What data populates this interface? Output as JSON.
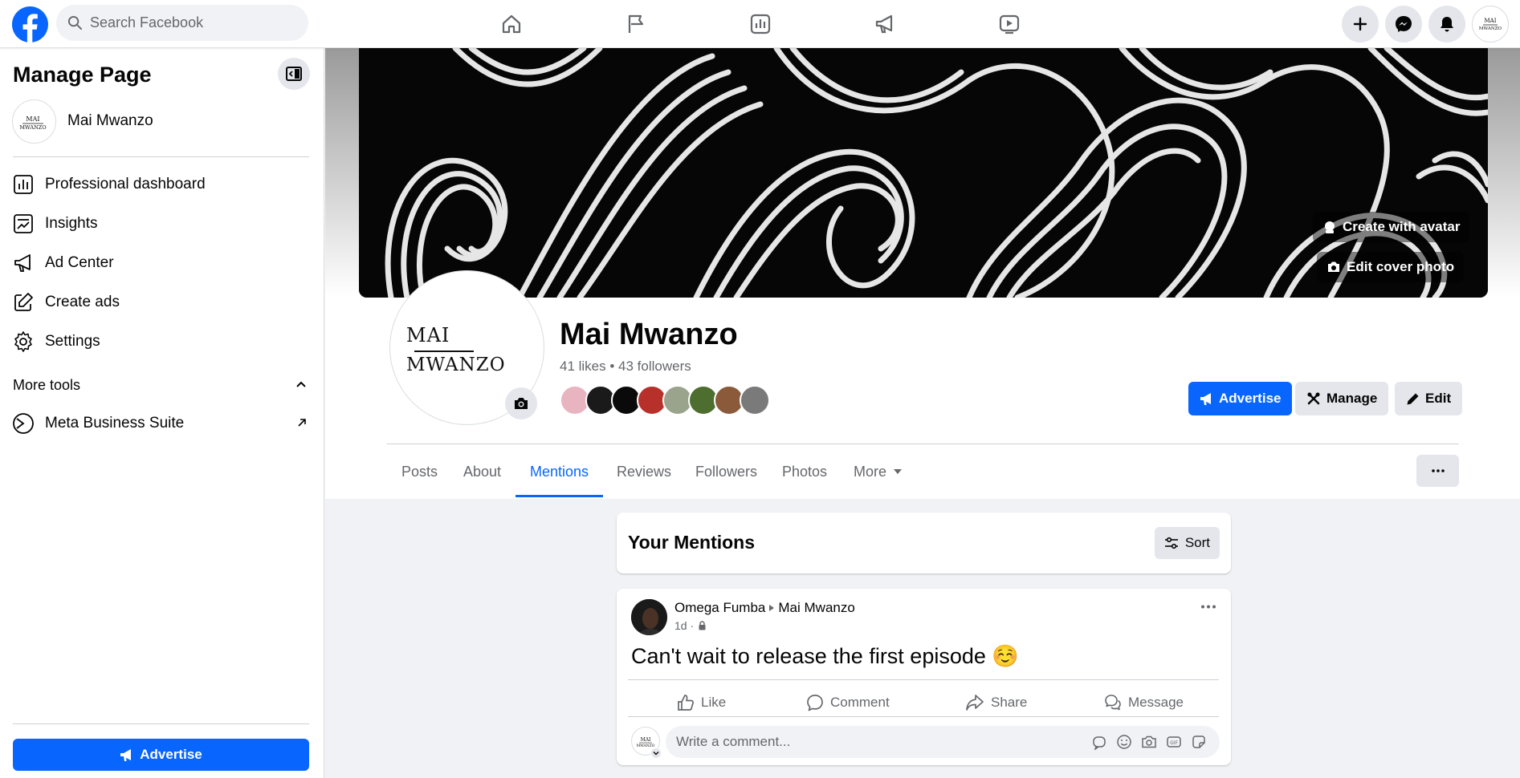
{
  "topbar": {
    "search_placeholder": "Search Facebook",
    "nav_icons": [
      "home-icon",
      "flag-icon",
      "insights-chart-icon",
      "megaphone-icon",
      "video-icon"
    ],
    "right_icons": [
      "plus-icon",
      "messenger-icon",
      "bell-icon",
      "account-avatar"
    ]
  },
  "sidebar": {
    "title": "Manage Page",
    "page_name": "Mai Mwanzo",
    "items": [
      {
        "label": "Professional dashboard",
        "icon": "dashboard-icon"
      },
      {
        "label": "Insights",
        "icon": "insights-icon"
      },
      {
        "label": "Ad Center",
        "icon": "megaphone-icon"
      },
      {
        "label": "Create ads",
        "icon": "pencil-square-icon"
      },
      {
        "label": "Settings",
        "icon": "gear-icon"
      }
    ],
    "more_tools": "More tools",
    "tool_items": [
      {
        "label": "Meta Business Suite",
        "icon": "meta-business-suite-icon"
      }
    ],
    "advertise_label": "Advertise"
  },
  "profile": {
    "logo_line1": "MAI",
    "logo_line2": "MWANZO",
    "name": "Mai Mwanzo",
    "stats": "41 likes • 43 followers",
    "follower_colors": [
      "#e8b4c0",
      "#1a1a1a",
      "#0a0a0a",
      "#b8302a",
      "#9aa38c",
      "#4d6e2e",
      "#8a5a3a",
      "#7a7a7a"
    ],
    "cover_buttons": {
      "create_avatar": "Create with avatar",
      "edit_cover": "Edit cover photo"
    },
    "actions": {
      "advertise": "Advertise",
      "manage": "Manage",
      "edit": "Edit"
    }
  },
  "tabs": [
    {
      "label": "Posts",
      "active": false
    },
    {
      "label": "About",
      "active": false
    },
    {
      "label": "Mentions",
      "active": true
    },
    {
      "label": "Reviews",
      "active": false
    },
    {
      "label": "Followers",
      "active": false
    },
    {
      "label": "Photos",
      "active": false
    },
    {
      "label": "More",
      "active": false
    }
  ],
  "mentions": {
    "title": "Your Mentions",
    "sort_label": "Sort"
  },
  "post": {
    "author": "Omega Fumba",
    "target": "Mai Mwanzo",
    "time": "1d ·",
    "text": "Can't wait to release the first episode ☺️",
    "actions": {
      "like": "Like",
      "comment": "Comment",
      "share": "Share",
      "message": "Message"
    },
    "comment_placeholder": "Write a comment..."
  },
  "colors": {
    "brand": "#0866ff",
    "secondary_button": "#e4e6eb",
    "muted_text": "#65676b"
  }
}
